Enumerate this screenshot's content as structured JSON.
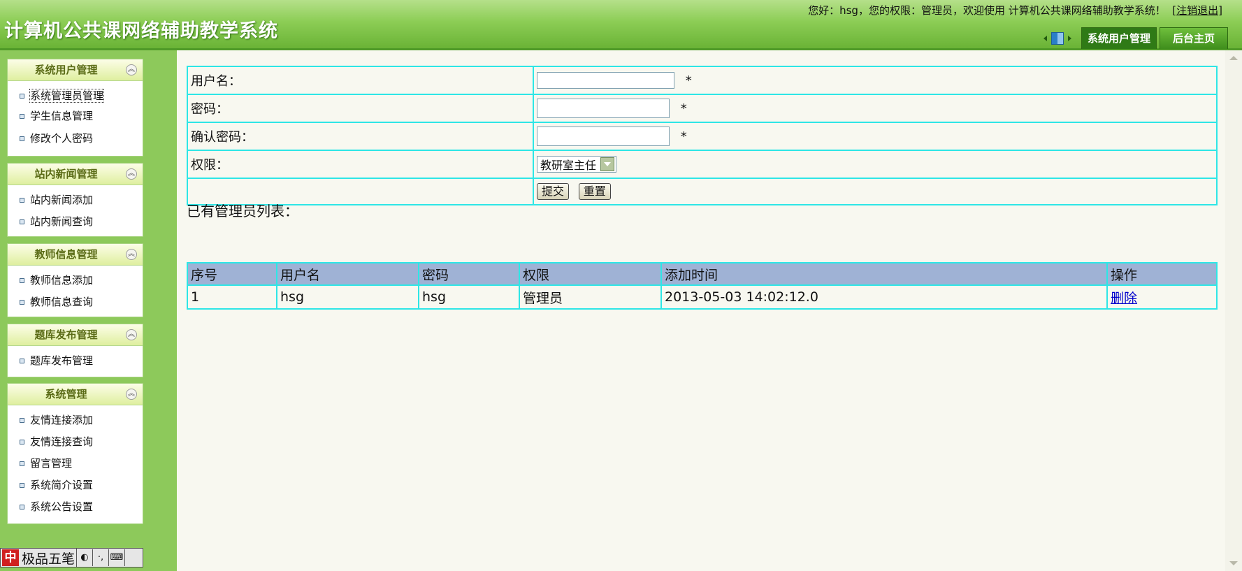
{
  "header": {
    "app_title": "计算机公共课网络辅助教学系统",
    "welcome_text": "您好：hsg，您的权限：管理员，欢迎使用 计算机公共课网络辅助教学系统！",
    "logout": "[注销退出]",
    "tabs": [
      {
        "label": "系统用户管理",
        "active": true
      },
      {
        "label": "后台主页",
        "active": false
      }
    ]
  },
  "sidebar": {
    "panels": [
      {
        "title": "系统用户管理",
        "items": [
          "系统管理员管理",
          "学生信息管理",
          "修改个人密码"
        ]
      },
      {
        "title": "站内新闻管理",
        "items": [
          "站内新闻添加",
          "站内新闻查询"
        ]
      },
      {
        "title": "教师信息管理",
        "items": [
          "教师信息添加",
          "教师信息查询"
        ]
      },
      {
        "title": "题库发布管理",
        "items": [
          "题库发布管理"
        ]
      },
      {
        "title": "系统管理",
        "items": [
          "友情连接添加",
          "友情连接查询",
          "留言管理",
          "系统简介设置",
          "系统公告设置"
        ]
      }
    ],
    "ime": {
      "logo": "中",
      "name": "极品五笔",
      "icons": [
        "moon-icon",
        "punctuation-icon",
        "keyboard-icon"
      ]
    }
  },
  "form": {
    "username_label": "用户名：",
    "password_label": "密码：",
    "confirm_label": "确认密码：",
    "permission_label": "权限：",
    "required_mark": "*",
    "username_value": "",
    "password_value": "",
    "confirm_value": "",
    "permission_selected": "教研室主任",
    "submit_label": "提交",
    "reset_label": "重置"
  },
  "list": {
    "title": "已有管理员列表：",
    "columns": [
      "序号",
      "用户名",
      "密码",
      "权限",
      "添加时间",
      "操作"
    ],
    "rows": [
      {
        "id": "1",
        "username": "hsg",
        "password": "hsg",
        "permission": "管理员",
        "added": "2013-05-03 14:02:12.0",
        "action": "删除"
      }
    ]
  },
  "colors": {
    "header_green": "#6ab336",
    "sidebar_green": "#8dc95b",
    "table_border": "#2ee6e6",
    "table_header": "#9fb2d5"
  }
}
